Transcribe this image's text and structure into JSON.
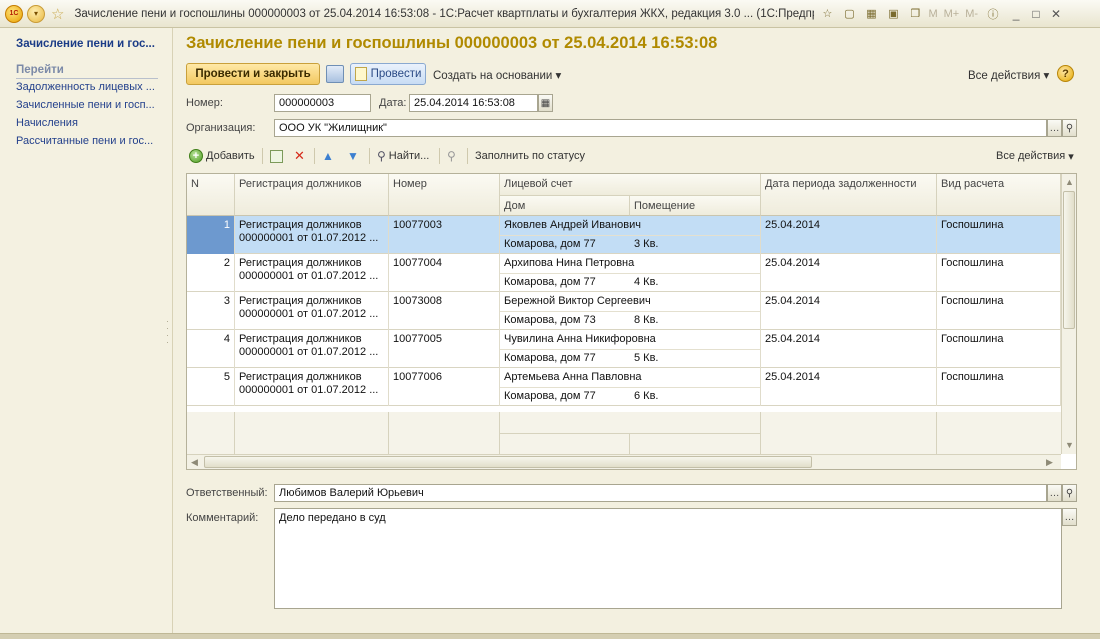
{
  "window": {
    "title": "Зачисление пени и госпошлины 000000003 от 25.04.2014 16:53:08 - 1С:Расчет квартплаты и бухгалтерия ЖКХ, редакция 3.0 ...  (1С:Предприятие)",
    "logo_text": "1С",
    "memory_buttons": [
      "M",
      "M+",
      "M-"
    ],
    "window_controls": [
      "_",
      "□",
      "✕"
    ]
  },
  "sidebar": {
    "title": "Зачисление пени и гос...",
    "goto_label": "Перейти",
    "links": [
      "Задолженность лицевых ...",
      "Зачисленные пени и госп...",
      "Начисления",
      "Рассчитанные пени и гос..."
    ]
  },
  "document": {
    "title": "Зачисление пени и госпошлины 000000003 от 25.04.2014 16:53:08"
  },
  "toolbar": {
    "post_and_close": "Провести и закрыть",
    "post": "Провести",
    "create_based_on": "Создать на основании",
    "all_actions": "Все действия",
    "help": "?"
  },
  "form": {
    "number_label": "Номер:",
    "number_value": "000000003",
    "date_label": "Дата:",
    "date_value": "25.04.2014 16:53:08",
    "organization_label": "Организация:",
    "organization_value": "ООО УК \"Жилищник\"",
    "responsible_label": "Ответственный:",
    "responsible_value": "Любимов Валерий Юрьевич",
    "comment_label": "Комментарий:",
    "comment_value": "Дело передано в суд"
  },
  "table_toolbar": {
    "add": "Добавить",
    "find": "Найти...",
    "fill_by_status": "Заполнить по статусу",
    "all_actions": "Все действия"
  },
  "table": {
    "headers": {
      "n": "N",
      "registration": "Регистрация должников",
      "number": "Номер",
      "account": "Лицевой счет",
      "house": "Дом",
      "premises": "Помещение",
      "debt_date": "Дата периода задолженности",
      "calc_type": "Вид расчета"
    },
    "rows": [
      {
        "n": "1",
        "reg1": "Регистрация должников",
        "reg2": "000000001 от 01.07.2012 ...",
        "number": "10077003",
        "account": "Яковлев Андрей Иванович",
        "house": "Комарова, дом 77",
        "premises": "3 Кв.",
        "date": "25.04.2014",
        "type": "Госпошлина"
      },
      {
        "n": "2",
        "reg1": "Регистрация должников",
        "reg2": "000000001 от 01.07.2012 ...",
        "number": "10077004",
        "account": "Архипова Нина Петровна",
        "house": "Комарова, дом 77",
        "premises": "4 Кв.",
        "date": "25.04.2014",
        "type": "Госпошлина"
      },
      {
        "n": "3",
        "reg1": "Регистрация должников",
        "reg2": "000000001 от 01.07.2012 ...",
        "number": "10073008",
        "account": "Бережной Виктор Сергеевич",
        "house": "Комарова, дом 73",
        "premises": "8 Кв.",
        "date": "25.04.2014",
        "type": "Госпошлина"
      },
      {
        "n": "4",
        "reg1": "Регистрация должников",
        "reg2": "000000001 от 01.07.2012 ...",
        "number": "10077005",
        "account": "Чувилина Анна Никифоровна",
        "house": "Комарова, дом 77",
        "premises": "5 Кв.",
        "date": "25.04.2014",
        "type": "Госпошлина"
      },
      {
        "n": "5",
        "reg1": "Регистрация должников",
        "reg2": "000000001 от 01.07.2012 ...",
        "number": "10077006",
        "account": "Артемьева Анна Павловна",
        "house": "Комарова, дом 77",
        "premises": "6 Кв.",
        "date": "25.04.2014",
        "type": "Госпошлина"
      }
    ]
  }
}
